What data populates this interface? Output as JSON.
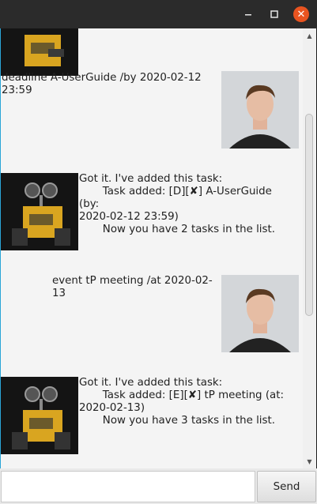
{
  "window": {
    "controls": {
      "minimize": "minimize-icon",
      "maximize": "maximize-icon",
      "close": "close-icon"
    }
  },
  "messages": [
    {
      "sender": "user",
      "text": "deadline A-UserGuide /by 2020-02-12\n23:59"
    },
    {
      "sender": "duke",
      "text": "Got it. I've added this task:\n       Task added: [D][✘] A-UserGuide (by:\n2020-02-12 23:59)\n       Now you have 2 tasks in the list."
    },
    {
      "sender": "user",
      "text": "event tP meeting /at 2020-02-13"
    },
    {
      "sender": "duke",
      "text": "Got it. I've added this task:\n       Task added: [E][✘] tP meeting (at:\n2020-02-13)\n       Now you have 3 tasks in the list."
    }
  ],
  "input": {
    "value": "",
    "placeholder": ""
  },
  "send_label": "Send"
}
